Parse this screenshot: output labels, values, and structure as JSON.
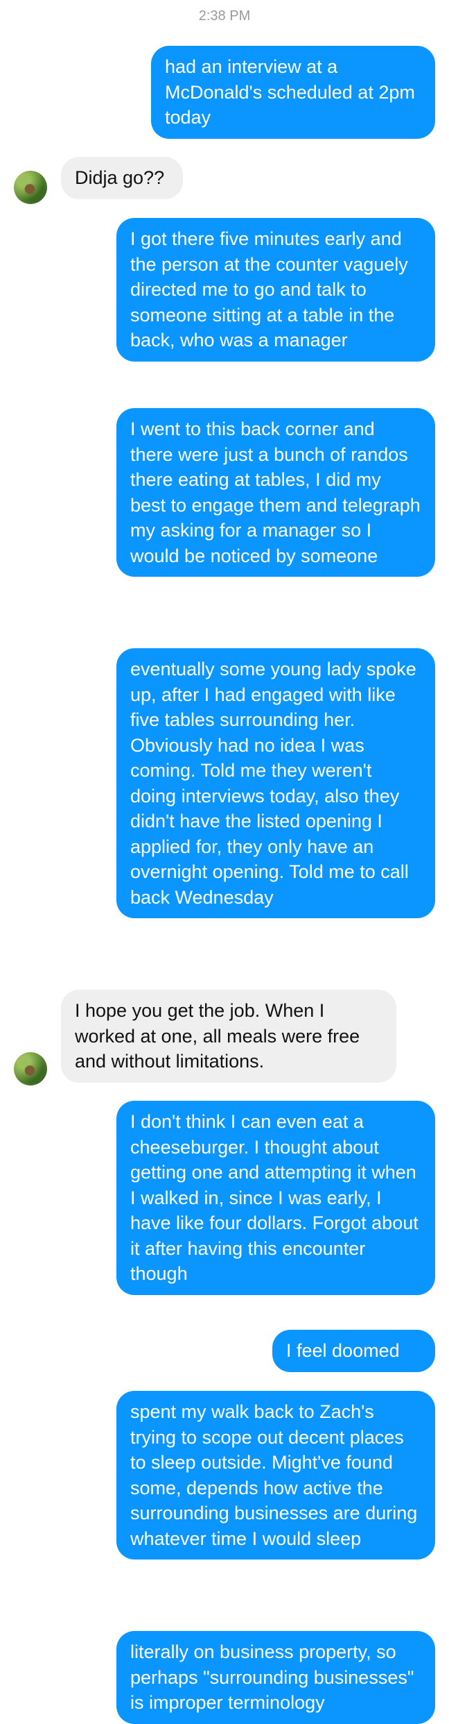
{
  "timestamp": "2:38 PM",
  "contact": {
    "avatar_icon": "avatar-photo-icon"
  },
  "colors": {
    "sent_bubble": "#0b95ff",
    "received_bubble": "#efefef"
  },
  "messages": [
    {
      "from": "me",
      "text": "had an interview at a McDonald's scheduled at 2pm today"
    },
    {
      "from": "them",
      "text": "Didja go??"
    },
    {
      "from": "me",
      "text": "I got there five minutes early and the person at the counter vaguely directed me to go and talk to someone sitting at a table in the back, who was a manager"
    },
    {
      "from": "me",
      "text": "I went to this back corner and there were just a bunch of randos there eating at tables, I did my best to engage them and telegraph my asking for a manager so I would be noticed by someone"
    },
    {
      "from": "me",
      "text": "eventually some young lady spoke up, after I had engaged with like five tables surrounding her. Obviously had no idea I was coming. Told me they weren't doing interviews today, also they didn't have the listed opening I applied for, they only have an overnight opening. Told me to call back Wednesday"
    },
    {
      "from": "them",
      "text": "I hope you get the job. When I worked at one, all meals were free and without limitations."
    },
    {
      "from": "me",
      "text": "I don't think I can even eat a cheeseburger. I thought about getting one and attempting it when I walked in, since I was early, I have like four dollars. Forgot about it after having this encounter though"
    },
    {
      "from": "me",
      "text": "I feel doomed"
    },
    {
      "from": "me",
      "text": "spent my walk back to Zach's trying to scope out decent places to sleep outside. Might've found some, depends how active the surrounding businesses are during whatever time I would sleep"
    },
    {
      "from": "me",
      "text": "literally on business property, so perhaps \"surrounding businesses\" is improper terminology"
    }
  ]
}
